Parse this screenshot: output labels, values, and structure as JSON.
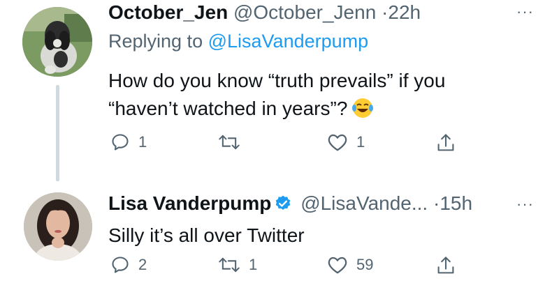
{
  "tweets": [
    {
      "name": "October_Jen",
      "handle": "@October_Jenn",
      "dot": "·",
      "time": "22h",
      "replying_prefix": "Replying to",
      "replying_to": "@LisaVanderpump",
      "text_line1": "How do you know “truth prevails” if you",
      "text_line2": "“haven’t watched in years”?",
      "emoji": "face-with-tears-of-joy",
      "more": "···",
      "replies": "1",
      "retweets": "",
      "likes": "1"
    },
    {
      "name": "Lisa Vanderpump",
      "verified": true,
      "handle": "@LisaVande...",
      "dot": "·",
      "time": "15h",
      "text_line1": "Silly it’s all over Twitter",
      "more": "···",
      "replies": "2",
      "retweets": "1",
      "likes": "59"
    }
  ],
  "colors": {
    "text": "#0f1419",
    "secondary": "#536471",
    "link": "#1d9bf0",
    "thread_line": "#cfd9de"
  }
}
